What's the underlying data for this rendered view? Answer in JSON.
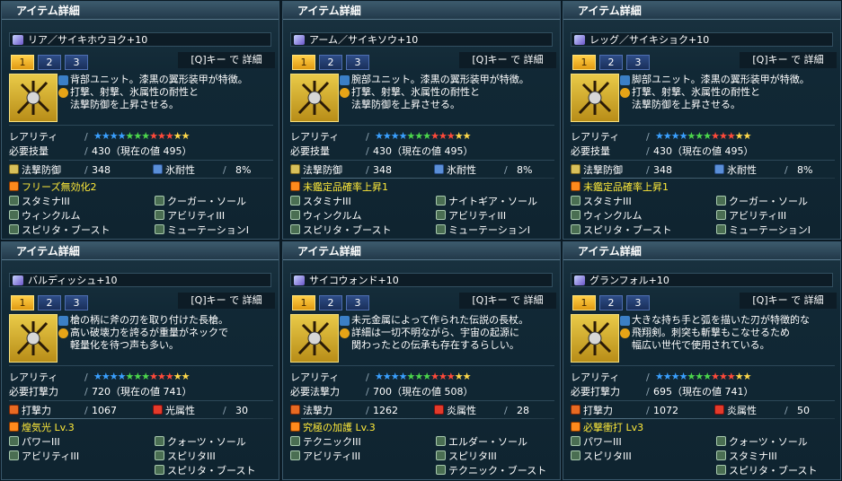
{
  "panels": [
    {
      "title": "アイテム詳細",
      "name": "リア／サイキホウヨク+10",
      "tabs": [
        "1",
        "2",
        "3"
      ],
      "qkey": "[Q]キー で 詳細",
      "desc": [
        "背部ユニット。漆黒の翼形装甲が特徴。",
        "打撃、射撃、氷属性の耐性と",
        "法撃防御を上昇させる。"
      ],
      "rarity_label": "レアリティ",
      "stars": "★★★★★★★★★★★★",
      "req_label": "必要技量",
      "req_value": "430（現在の値 495）",
      "stat1_label": "法撃防御",
      "stat1_value": "348",
      "stat2_label": "氷耐性",
      "stat2_value": "8%",
      "affixes": [
        "フリーズ無効化2",
        "クーガー・ソール",
        "スタミナIII",
        "アビリティIII",
        "ウィンクルム",
        "ミューテーションI",
        "スピリタ・ブースト"
      ]
    },
    {
      "title": "アイテム詳細",
      "name": "アーム／サイキソウ+10",
      "tabs": [
        "1",
        "2",
        "3"
      ],
      "qkey": "[Q]キー で 詳細",
      "desc": [
        "腕部ユニット。漆黒の翼形装甲が特徴。",
        "打撃、射撃、氷属性の耐性と",
        "法撃防御を上昇させる。"
      ],
      "rarity_label": "レアリティ",
      "stars": "★★★★★★★★★★★★",
      "req_label": "必要技量",
      "req_value": "430（現在の値 495）",
      "stat1_label": "法撃防御",
      "stat1_value": "348",
      "stat2_label": "氷耐性",
      "stat2_value": "8%",
      "affixes": [
        "未鑑定品確率上昇1",
        "ナイトギア・ソール",
        "スタミナIII",
        "アビリティIII",
        "ウィンクルム",
        "ミューテーションI",
        "スピリタ・ブースト"
      ]
    },
    {
      "title": "アイテム詳細",
      "name": "レッグ／サイキショク+10",
      "tabs": [
        "1",
        "2",
        "3"
      ],
      "qkey": "[Q]キー で 詳細",
      "desc": [
        "脚部ユニット。漆黒の翼形装甲が特徴。",
        "打撃、射撃、氷属性の耐性と",
        "法撃防御を上昇させる。"
      ],
      "rarity_label": "レアリティ",
      "stars": "★★★★★★★★★★★★",
      "req_label": "必要技量",
      "req_value": "430（現在の値 495）",
      "stat1_label": "法撃防御",
      "stat1_value": "348",
      "stat2_label": "氷耐性",
      "stat2_value": "8%",
      "affixes": [
        "未鑑定品確率上昇1",
        "クーガー・ソール",
        "スタミナIII",
        "アビリティIII",
        "ウィンクルム",
        "ミューテーションI",
        "スピリタ・ブースト"
      ]
    },
    {
      "title": "アイテム詳細",
      "name": "バルディッシュ+10",
      "tabs": [
        "1",
        "2",
        "3"
      ],
      "qkey": "[Q]キー で 詳細",
      "desc": [
        "槍の柄に斧の刃を取り付けた長槍。",
        "高い破壊力を誇るが重量がネックで",
        "軽量化を待つ声も多い。"
      ],
      "rarity_label": "レアリティ",
      "stars": "★★★★★★★★★★★★",
      "req_label": "必要打撃力",
      "req_value": "720（現在の値 741）",
      "stat1_label": "打撃力",
      "stat1_value": "1067",
      "stat2_label": "光属性",
      "stat2_value": "30",
      "affixes": [
        "煌気光 Lv.3",
        "クォーツ・ソール",
        "パワーIII",
        "スピリタIII",
        "アビリティIII",
        "スピリタ・ブースト"
      ]
    },
    {
      "title": "アイテム詳細",
      "name": "サイコウォンド+10",
      "tabs": [
        "1",
        "2",
        "3"
      ],
      "qkey": "[Q]キー で 詳細",
      "desc": [
        "未元金属によって作られた伝説の長杖。",
        "詳細は一切不明ながら、宇宙の起源に",
        "関わったとの伝承も存在するらしい。"
      ],
      "rarity_label": "レアリティ",
      "stars": "★★★★★★★★★★★★",
      "req_label": "必要法撃力",
      "req_value": "700（現在の値 508）",
      "stat1_label": "法撃力",
      "stat1_value": "1262",
      "stat2_label": "炎属性",
      "stat2_value": "28",
      "affixes": [
        "究極の加護 Lv.3",
        "エルダー・ソール",
        "テクニックIII",
        "スピリタIII",
        "アビリティIII",
        "テクニック・ブースト"
      ]
    },
    {
      "title": "アイテム詳細",
      "name": "グランフォル+10",
      "tabs": [
        "1",
        "2",
        "3"
      ],
      "qkey": "[Q]キー で 詳細",
      "desc": [
        "大きな持ち手と弧を描いた刃が特徴的な",
        "飛翔剣。刺突も斬撃もこなせるため",
        "幅広い世代で使用されている。"
      ],
      "rarity_label": "レアリティ",
      "stars": "★★★★★★★★★★★★",
      "req_label": "必要打撃力",
      "req_value": "695（現在の値 741）",
      "stat1_label": "打撃力",
      "stat1_value": "1072",
      "stat2_label": "炎属性",
      "stat2_value": "50",
      "affixes": [
        "必撃衝打 Lv3",
        "クォーツ・ソール",
        "パワーIII",
        "スタミナIII",
        "スピリタIII",
        "スピリタ・ブースト"
      ]
    }
  ],
  "colors": {
    "star_blue": "#3aa0ff",
    "star_green": "#4cd64c",
    "star_red": "#ff4a3a",
    "star_yellow": "#ffd84a",
    "affix_highlight": "#ffea3a"
  }
}
